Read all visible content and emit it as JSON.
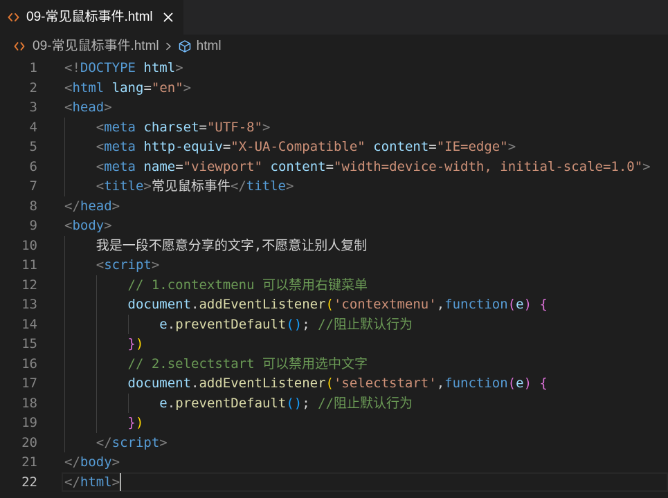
{
  "colors": {
    "editor-bg": "#1e1e1e",
    "tabbar-bg": "#252526",
    "tab-label": "#ffffff",
    "breadcrumb-text": "#b4b4b4",
    "html-icon": "#e37933",
    "symbol-icon": "#75beff",
    "line-number": "#858585",
    "line-number-active": "#c6c6c6",
    "code-text": "#d4d4d4",
    "indent-guide": "#404040",
    "line-highlight-border": "#282828",
    "cursor": "#aeafad"
  },
  "tabs": [
    {
      "label": "09-常见鼠标事件.html",
      "icon": "html-file-icon",
      "close_icon": "close-icon",
      "active": true
    }
  ],
  "breadcrumb": {
    "file_icon": "html-file-icon",
    "file": "09-常见鼠标事件.html",
    "separator_icon": "chevron-right-icon",
    "symbol_icon": "symbol-cube-icon",
    "symbol": "html"
  },
  "editor": {
    "lines": [
      {
        "n": "1",
        "tokens": [
          {
            "t": "<!",
            "c": "#808080"
          },
          {
            "t": "DOCTYPE",
            "c": "#569cd6"
          },
          {
            "t": " "
          },
          {
            "t": "html",
            "c": "#9cdcfe"
          },
          {
            "t": ">",
            "c": "#808080"
          }
        ]
      },
      {
        "n": "2",
        "tokens": [
          {
            "t": "<",
            "c": "#808080"
          },
          {
            "t": "html",
            "c": "#569cd6"
          },
          {
            "t": " "
          },
          {
            "t": "lang",
            "c": "#9cdcfe"
          },
          {
            "t": "="
          },
          {
            "t": "\"en\"",
            "c": "#ce9178"
          },
          {
            "t": ">",
            "c": "#808080"
          }
        ]
      },
      {
        "n": "3",
        "tokens": [
          {
            "t": "<",
            "c": "#808080"
          },
          {
            "t": "head",
            "c": "#569cd6"
          },
          {
            "t": ">",
            "c": "#808080"
          }
        ]
      },
      {
        "n": "4",
        "tokens": [
          {
            "t": "    "
          },
          {
            "t": "<",
            "c": "#808080"
          },
          {
            "t": "meta",
            "c": "#569cd6"
          },
          {
            "t": " "
          },
          {
            "t": "charset",
            "c": "#9cdcfe"
          },
          {
            "t": "="
          },
          {
            "t": "\"UTF-8\"",
            "c": "#ce9178"
          },
          {
            "t": ">",
            "c": "#808080"
          }
        ]
      },
      {
        "n": "5",
        "tokens": [
          {
            "t": "    "
          },
          {
            "t": "<",
            "c": "#808080"
          },
          {
            "t": "meta",
            "c": "#569cd6"
          },
          {
            "t": " "
          },
          {
            "t": "http-equiv",
            "c": "#9cdcfe"
          },
          {
            "t": "="
          },
          {
            "t": "\"X-UA-Compatible\"",
            "c": "#ce9178"
          },
          {
            "t": " "
          },
          {
            "t": "content",
            "c": "#9cdcfe"
          },
          {
            "t": "="
          },
          {
            "t": "\"IE=edge\"",
            "c": "#ce9178"
          },
          {
            "t": ">",
            "c": "#808080"
          }
        ]
      },
      {
        "n": "6",
        "tokens": [
          {
            "t": "    "
          },
          {
            "t": "<",
            "c": "#808080"
          },
          {
            "t": "meta",
            "c": "#569cd6"
          },
          {
            "t": " "
          },
          {
            "t": "name",
            "c": "#9cdcfe"
          },
          {
            "t": "="
          },
          {
            "t": "\"viewport\"",
            "c": "#ce9178"
          },
          {
            "t": " "
          },
          {
            "t": "content",
            "c": "#9cdcfe"
          },
          {
            "t": "="
          },
          {
            "t": "\"width=device-width, initial-scale=1.0\"",
            "c": "#ce9178"
          },
          {
            "t": ">",
            "c": "#808080"
          }
        ]
      },
      {
        "n": "7",
        "tokens": [
          {
            "t": "    "
          },
          {
            "t": "<",
            "c": "#808080"
          },
          {
            "t": "title",
            "c": "#569cd6"
          },
          {
            "t": ">",
            "c": "#808080"
          },
          {
            "t": "常见鼠标事件"
          },
          {
            "t": "</",
            "c": "#808080"
          },
          {
            "t": "title",
            "c": "#569cd6"
          },
          {
            "t": ">",
            "c": "#808080"
          }
        ]
      },
      {
        "n": "8",
        "tokens": [
          {
            "t": "</",
            "c": "#808080"
          },
          {
            "t": "head",
            "c": "#569cd6"
          },
          {
            "t": ">",
            "c": "#808080"
          }
        ]
      },
      {
        "n": "9",
        "tokens": [
          {
            "t": "<",
            "c": "#808080"
          },
          {
            "t": "body",
            "c": "#569cd6"
          },
          {
            "t": ">",
            "c": "#808080"
          }
        ]
      },
      {
        "n": "10",
        "tokens": [
          {
            "t": "    "
          },
          {
            "t": "我是一段不愿意分享的文字,不愿意让别人复制"
          }
        ]
      },
      {
        "n": "11",
        "tokens": [
          {
            "t": "    "
          },
          {
            "t": "<",
            "c": "#808080"
          },
          {
            "t": "script",
            "c": "#569cd6"
          },
          {
            "t": ">",
            "c": "#808080"
          }
        ]
      },
      {
        "n": "12",
        "tokens": [
          {
            "t": "        "
          },
          {
            "t": "// 1.contextmenu 可以禁用右键菜单",
            "c": "#6a9955"
          }
        ]
      },
      {
        "n": "13",
        "tokens": [
          {
            "t": "        "
          },
          {
            "t": "document",
            "c": "#9cdcfe"
          },
          {
            "t": "."
          },
          {
            "t": "addEventListener",
            "c": "#dcdcaa"
          },
          {
            "t": "(",
            "c": "#ffd700"
          },
          {
            "t": "'contextmenu'",
            "c": "#ce9178"
          },
          {
            "t": ","
          },
          {
            "t": "function",
            "c": "#569cd6"
          },
          {
            "t": "(",
            "c": "#da70d6"
          },
          {
            "t": "e",
            "c": "#9cdcfe"
          },
          {
            "t": ")",
            "c": "#da70d6"
          },
          {
            "t": " "
          },
          {
            "t": "{",
            "c": "#da70d6"
          }
        ]
      },
      {
        "n": "14",
        "tokens": [
          {
            "t": "            "
          },
          {
            "t": "e",
            "c": "#9cdcfe"
          },
          {
            "t": "."
          },
          {
            "t": "preventDefault",
            "c": "#dcdcaa"
          },
          {
            "t": "()",
            "c": "#179fff"
          },
          {
            "t": "; "
          },
          {
            "t": "//阻止默认行为",
            "c": "#6a9955"
          }
        ]
      },
      {
        "n": "15",
        "tokens": [
          {
            "t": "        "
          },
          {
            "t": "}",
            "c": "#da70d6"
          },
          {
            "t": ")",
            "c": "#ffd700"
          }
        ]
      },
      {
        "n": "16",
        "tokens": [
          {
            "t": "        "
          },
          {
            "t": "// 2.selectstart 可以禁用选中文字",
            "c": "#6a9955"
          }
        ]
      },
      {
        "n": "17",
        "tokens": [
          {
            "t": "        "
          },
          {
            "t": "document",
            "c": "#9cdcfe"
          },
          {
            "t": "."
          },
          {
            "t": "addEventListener",
            "c": "#dcdcaa"
          },
          {
            "t": "(",
            "c": "#ffd700"
          },
          {
            "t": "'selectstart'",
            "c": "#ce9178"
          },
          {
            "t": ","
          },
          {
            "t": "function",
            "c": "#569cd6"
          },
          {
            "t": "(",
            "c": "#da70d6"
          },
          {
            "t": "e",
            "c": "#9cdcfe"
          },
          {
            "t": ")",
            "c": "#da70d6"
          },
          {
            "t": " "
          },
          {
            "t": "{",
            "c": "#da70d6"
          }
        ]
      },
      {
        "n": "18",
        "tokens": [
          {
            "t": "            "
          },
          {
            "t": "e",
            "c": "#9cdcfe"
          },
          {
            "t": "."
          },
          {
            "t": "preventDefault",
            "c": "#dcdcaa"
          },
          {
            "t": "()",
            "c": "#179fff"
          },
          {
            "t": "; "
          },
          {
            "t": "//阻止默认行为",
            "c": "#6a9955"
          }
        ]
      },
      {
        "n": "19",
        "tokens": [
          {
            "t": "        "
          },
          {
            "t": "}",
            "c": "#da70d6"
          },
          {
            "t": ")",
            "c": "#ffd700"
          }
        ]
      },
      {
        "n": "20",
        "tokens": [
          {
            "t": "    "
          },
          {
            "t": "</",
            "c": "#808080"
          },
          {
            "t": "script",
            "c": "#569cd6"
          },
          {
            "t": ">",
            "c": "#808080"
          }
        ]
      },
      {
        "n": "21",
        "tokens": [
          {
            "t": "</",
            "c": "#808080"
          },
          {
            "t": "body",
            "c": "#569cd6"
          },
          {
            "t": ">",
            "c": "#808080"
          }
        ]
      },
      {
        "n": "22",
        "active": true,
        "tokens": [
          {
            "t": "</",
            "c": "#808080"
          },
          {
            "t": "html",
            "c": "#569cd6"
          },
          {
            "t": ">",
            "c": "#808080"
          }
        ]
      }
    ]
  }
}
